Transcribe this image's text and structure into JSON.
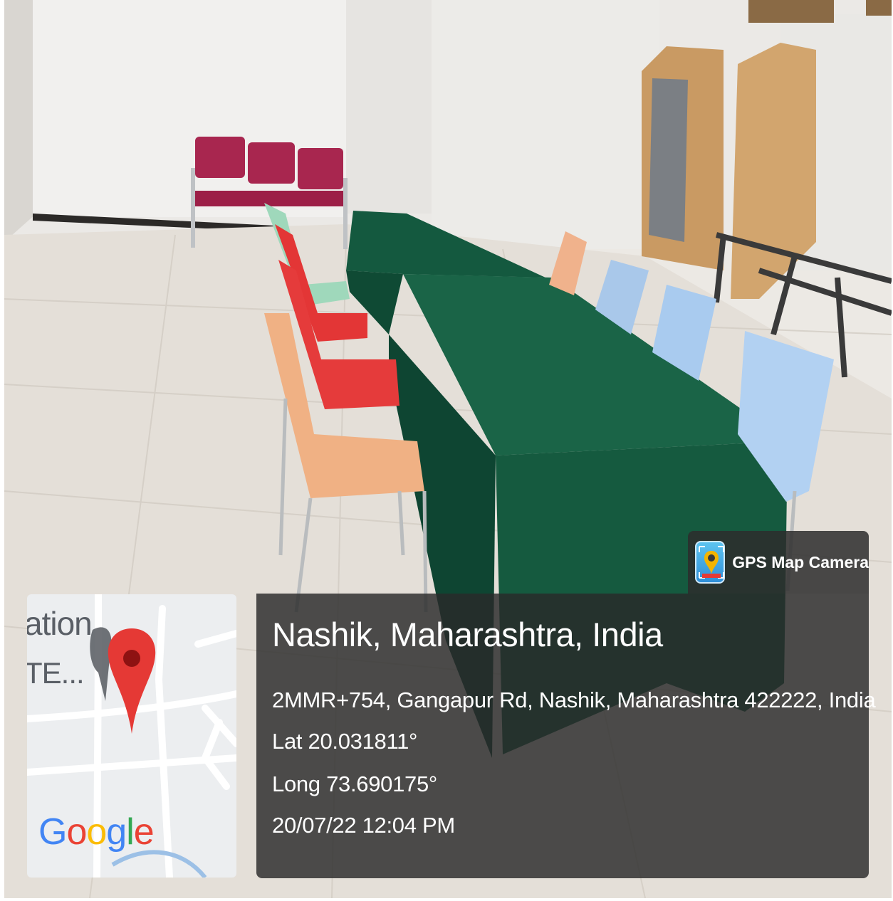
{
  "photo": {
    "scene": "conference-room"
  },
  "map_thumbnail": {
    "label_top": "ation",
    "label_bottom": "TE...",
    "pin_color": "#e53935",
    "logo_text": "Google",
    "logo_colors": [
      "#4285f4",
      "#ea4335",
      "#fbbc05",
      "#4285f4",
      "#34a853",
      "#ea4335"
    ]
  },
  "gps_badge": {
    "label": "GPS Map Camera",
    "icon": "gps-map-camera-app-icon"
  },
  "location": {
    "title": "Nashik, Maharashtra, India",
    "address": "2MMR+754, Gangapur Rd, Nashik, Maharashtra 422222, India",
    "latitude": "Lat 20.031811°",
    "longitude": "Long 73.690175°",
    "datetime": "20/07/22 12:04 PM"
  }
}
